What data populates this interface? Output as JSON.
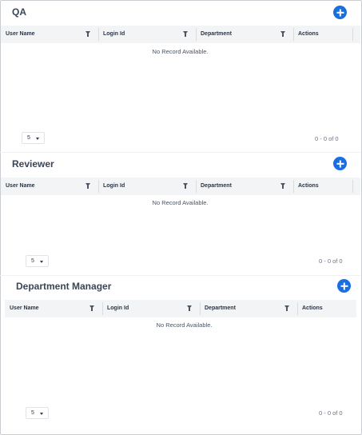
{
  "sections": [
    {
      "title": "QA",
      "add_label": "+",
      "columns": [
        "User Name",
        "Login Id",
        "Department",
        "Actions"
      ],
      "empty_message": "No Record Available.",
      "page_size": "5",
      "range": "0 - 0 of 0"
    },
    {
      "title": "Reviewer",
      "add_label": "+",
      "columns": [
        "User Name",
        "Login Id",
        "Department",
        "Actions"
      ],
      "empty_message": "No Record Available.",
      "page_size": "5",
      "range": "0 - 0 of 0"
    },
    {
      "title": "Department Manager",
      "add_label": "+",
      "columns": [
        "User Name",
        "Login Id",
        "Department",
        "Actions"
      ],
      "empty_message": "",
      "page_size": "5",
      "range": "0 - 0 of 0"
    }
  ],
  "icons": {
    "add": "plus-circle-icon",
    "filter": "filter-icon",
    "dropdown": "chevron-down-icon"
  },
  "colors": {
    "accent": "#1a6fe0",
    "header_bg": "#f3f4f6",
    "title": "#3a4654"
  }
}
